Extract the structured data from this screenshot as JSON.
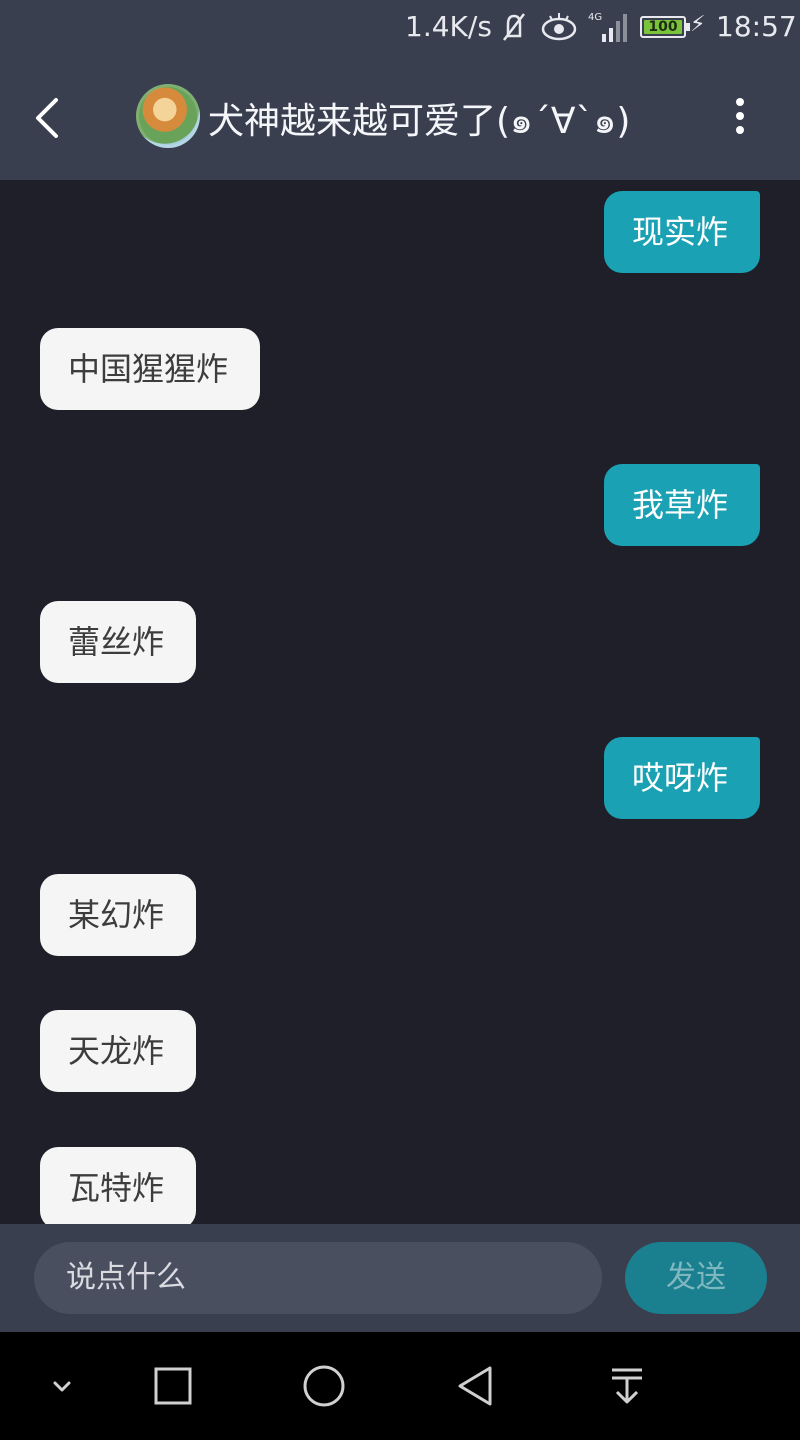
{
  "status_bar": {
    "speed": "1.4K/s",
    "network": "4G",
    "battery": "100",
    "time": "18:57",
    "icons": [
      "mute-icon",
      "eye-icon",
      "signal-icon",
      "battery-icon",
      "charging-icon"
    ]
  },
  "header": {
    "title": "犬神越来越可爱了(๑´∀`๑)",
    "back_icon": "back-icon",
    "more_icon": "more-icon"
  },
  "messages": [
    {
      "side": "right",
      "text": "现实炸"
    },
    {
      "side": "left",
      "text": "中国猩猩炸"
    },
    {
      "side": "right",
      "text": "我草炸"
    },
    {
      "side": "left",
      "text": "蕾丝炸"
    },
    {
      "side": "right",
      "text": "哎呀炸"
    },
    {
      "side": "left",
      "text": "某幻炸"
    },
    {
      "side": "left",
      "text": "天龙炸"
    },
    {
      "side": "left",
      "text": "瓦特炸"
    }
  ],
  "input": {
    "placeholder": "说点什么",
    "send_label": "发送"
  },
  "colors": {
    "header_bg": "#3a3f4f",
    "chat_bg": "#1f1f29",
    "right_bubble": "#1aa2b4",
    "left_bubble": "#f5f5f5",
    "send_button": "#1a7f8e"
  }
}
